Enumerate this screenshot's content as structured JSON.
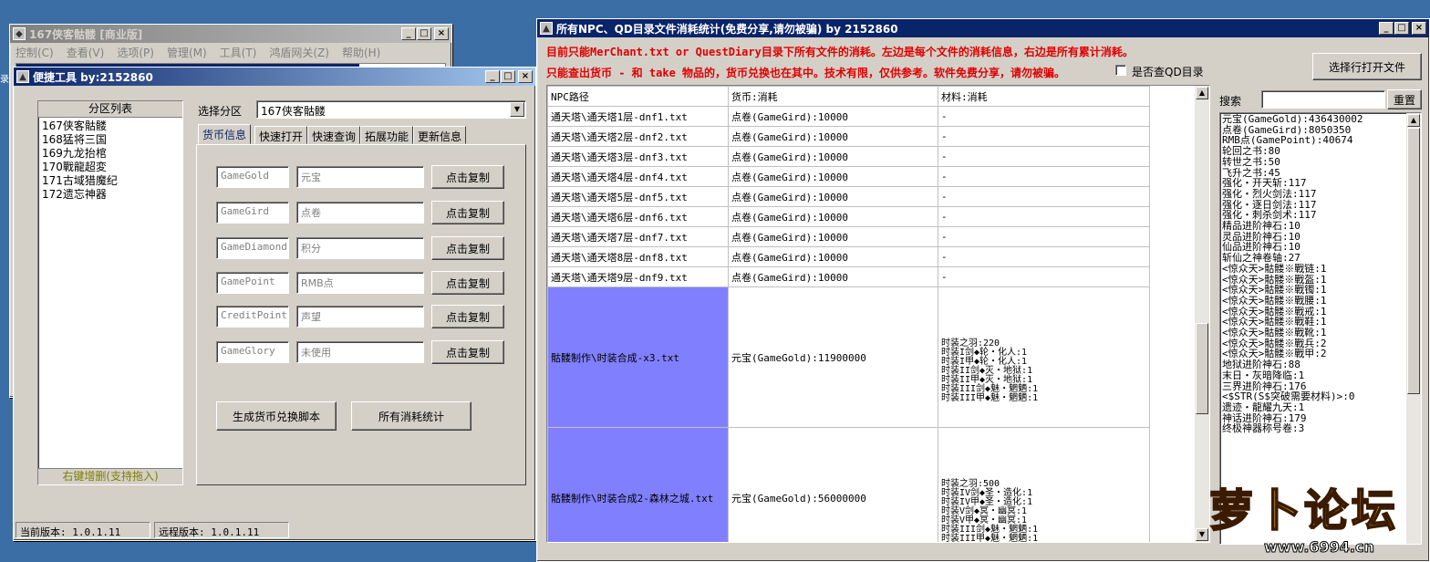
{
  "win_main": {
    "title": "167侠客骷髅 [商业版]",
    "menu": [
      "控制(C)",
      "查看(V)",
      "选项(P)",
      "管理(M)",
      "工具(T)",
      "鸿盾网关(Z)",
      "帮助(H)"
    ]
  },
  "win_quick": {
    "title": "便捷工具  by:2152860",
    "zone_list_header": "分区列表",
    "zones": [
      "167侠客骷髅",
      "168猛将三国",
      "169九龙抬棺",
      "170戰龍超変",
      "171古域猎魔纪",
      "172遗忘神器"
    ],
    "zone_list_footer": "右键增删(支持拖入)",
    "select_label": "选择分区",
    "select_value": "167侠客骷髅",
    "tabs": [
      "货币信息",
      "快速打开",
      "快速查询",
      "拓展功能",
      "更新信息"
    ],
    "currency_rows": [
      {
        "key": "GameGold",
        "name": "元宝",
        "button": "点击复制"
      },
      {
        "key": "GameGird",
        "name": "点卷",
        "button": "点击复制"
      },
      {
        "key": "GameDiamond",
        "name": "积分",
        "button": "点击复制"
      },
      {
        "key": "GamePoint",
        "name": "RMB点",
        "button": "点击复制"
      },
      {
        "key": "CreditPoint",
        "name": "声望",
        "button": "点击复制"
      },
      {
        "key": "GameGlory",
        "name": "未使用",
        "button": "点击复制"
      }
    ],
    "btn_generate": "生成货币兑换脚本",
    "btn_stats": "所有消耗统计",
    "status_current": "当前版本: 1.0.1.11",
    "status_remote": "远程版本: 1.0.1.11"
  },
  "win_stats": {
    "title": "所有NPC、QD目录文件消耗统计(免费分享,请勿被骗)     by 2152860",
    "notice1": "目前只能MerChant.txt or QuestDiary目录下所有文件的消耗。左边是每个文件的消耗信息，右边是所有累计消耗。",
    "notice2": "只能查出货币 - 和 take 物品的，货币兑换也在其中。技术有限，仅供参考。软件免费分享，请勿被骗。",
    "checkbox_label": "是否查QD目录",
    "btn_open": "选择行打开文件",
    "search_label": "搜索",
    "btn_reset": "重置",
    "columns": [
      "NPC路径",
      "货币:消耗",
      "材料:消耗"
    ],
    "rows": [
      {
        "path": "通天塔\\通天塔1层-dnf1.txt",
        "cost": "点卷(GameGird):10000",
        "mat": "-"
      },
      {
        "path": "通天塔\\通天塔2层-dnf2.txt",
        "cost": "点卷(GameGird):10000",
        "mat": "-"
      },
      {
        "path": "通天塔\\通天塔3层-dnf3.txt",
        "cost": "点卷(GameGird):10000",
        "mat": "-"
      },
      {
        "path": "通天塔\\通天塔4层-dnf4.txt",
        "cost": "点卷(GameGird):10000",
        "mat": "-"
      },
      {
        "path": "通天塔\\通天塔5层-dnf5.txt",
        "cost": "点卷(GameGird):10000",
        "mat": "-"
      },
      {
        "path": "通天塔\\通天塔6层-dnf6.txt",
        "cost": "点卷(GameGird):10000",
        "mat": "-"
      },
      {
        "path": "通天塔\\通天塔7层-dnf7.txt",
        "cost": "点卷(GameGird):10000",
        "mat": "-"
      },
      {
        "path": "通天塔\\通天塔8层-dnf8.txt",
        "cost": "点卷(GameGird):10000",
        "mat": "-"
      },
      {
        "path": "通天塔\\通天塔9层-dnf9.txt",
        "cost": "点卷(GameGird):10000",
        "mat": "-"
      }
    ],
    "big_rows": [
      {
        "path": "骷髅制作\\时装合成-x3.txt",
        "cost": "元宝(GameGold):11900000",
        "mats": [
          "时装之羽:220",
          "时装I剑◆轮・化人:1",
          "时装I甲◆轮・化人:1",
          "时装II剑◆灭・地狱:1",
          "时装II甲◆灭・地狱:1",
          "时装III剑◆魅・魍魉:1",
          "时装III甲◆魅・魍魉:1"
        ]
      },
      {
        "path": "骷髅制作\\时装合成2-森林之城.txt",
        "cost": "元宝(GameGold):56000000",
        "mats": [
          "时装之羽:500",
          "时装IV剑◆圣・造化:1",
          "时装IV甲◆圣・造化:1",
          "时装V剑◆冥・幽冥:1",
          "时装V甲◆冥・幽冥:1",
          "时装III剑◆魅・魍魉:1",
          "时装III甲◆魅・魍魉:1"
        ]
      }
    ],
    "totals": [
      "元宝(GameGold):436430002",
      "点卷(GameGird):8050350",
      "RMB点(GamePoint):40674",
      "轮回之书:80",
      "转世之书:50",
      "飞升之书:45",
      "强化・开天斩:117",
      "强化・烈火剑法:117",
      "强化・逐日剑法:117",
      "强化・刺杀剑术:117",
      "精品进阶神石:10",
      "灵品进阶神石:10",
      "仙品进阶神石:10",
      "斩仙之神卷轴:27",
      "<惊众天>骷髅※戰链:1",
      "<惊众天>骷髅※戰盔:1",
      "<惊众天>骷髅※戰镯:1",
      "<惊众天>骷髅※戰腰:1",
      "<惊众天>骷髅※戰戒:1",
      "<惊众天>骷髅※戰鞋:1",
      "<惊众天>骷髅※戰靴:1",
      "<惊众天>骷髅※戰兵:2",
      "<惊众天>骷髅※戰甲:2",
      "地狱进阶神石:88",
      "末日・灰暗降临:1",
      "三界进阶神石:176",
      "<$STR(S$突破需要材料)>:0",
      "遗迹・龍耀九天:1",
      "神话进阶神石:179",
      "终极神器称号卷:3"
    ]
  },
  "watermark": {
    "brand": "萝卜论坛",
    "url": "www.6994.cn"
  },
  "colors": {
    "titlebar": "#0a246a",
    "highlight": "#8080ff",
    "notice": "#e00000"
  }
}
